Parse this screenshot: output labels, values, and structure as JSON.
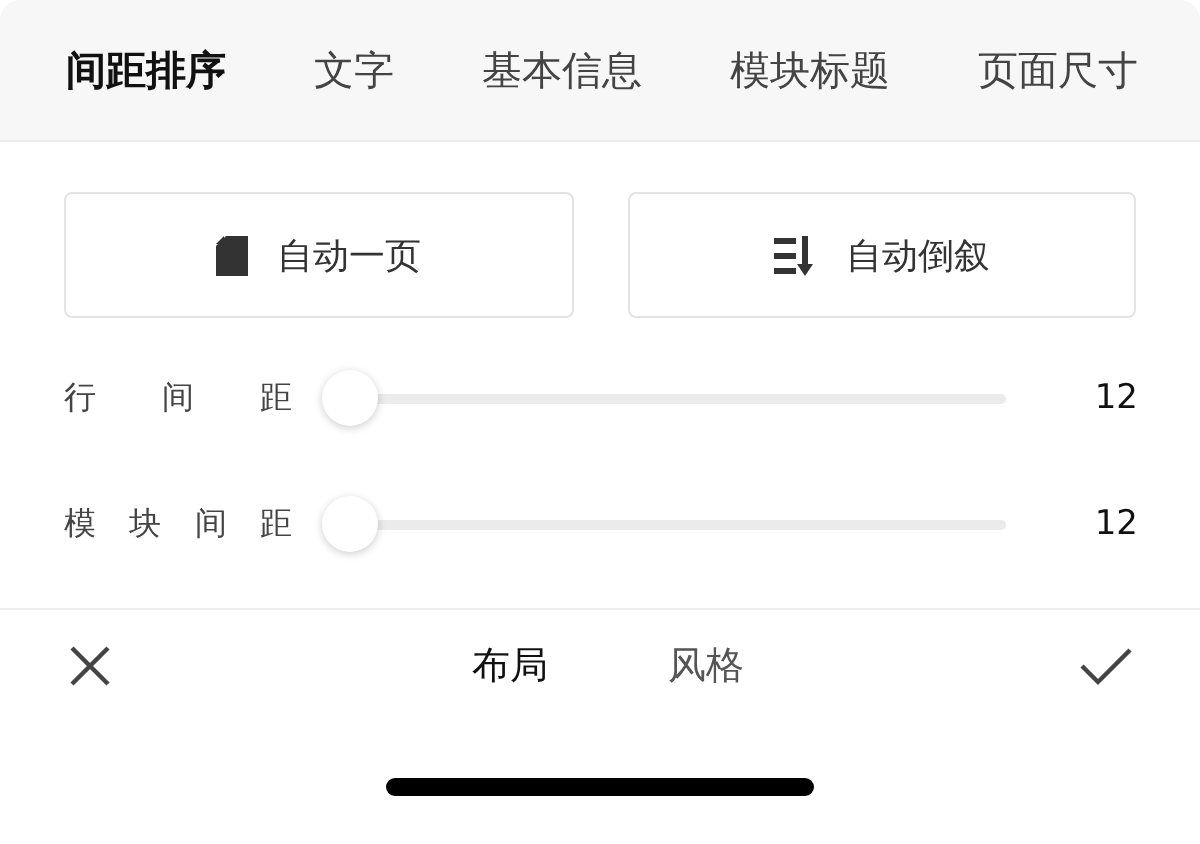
{
  "tabs": [
    {
      "label": "间距排序",
      "selected": true
    },
    {
      "label": "文字",
      "selected": false
    },
    {
      "label": "基本信息",
      "selected": false
    },
    {
      "label": "模块标题",
      "selected": false
    },
    {
      "label": "页面尺寸",
      "selected": false
    }
  ],
  "actions": [
    {
      "label": "自动一页",
      "kind": "page"
    },
    {
      "label": "自动倒叙",
      "kind": "sort"
    }
  ],
  "sliders": [
    {
      "label": "行间距",
      "level": 0,
      "reading": "12"
    },
    {
      "label": "模块间距",
      "level": 0,
      "reading": "12"
    }
  ],
  "bottom_tabs": [
    {
      "label": "布局",
      "selected": true
    },
    {
      "label": "风格",
      "selected": false
    }
  ]
}
